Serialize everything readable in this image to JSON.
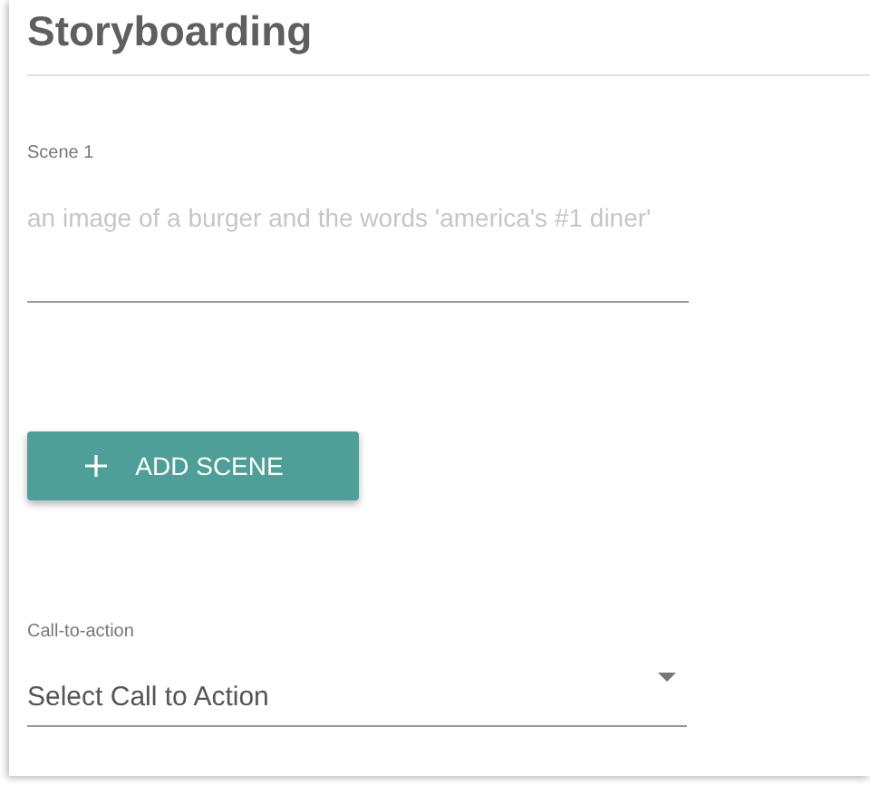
{
  "title": "Storyboarding",
  "scenes": [
    {
      "label": "Scene 1",
      "placeholder": "an image of a burger and the words 'america's #1 diner'"
    }
  ],
  "add_button": {
    "label": "ADD SCENE"
  },
  "call_to_action": {
    "label": "Call-to-action",
    "value": "Select Call to Action"
  }
}
